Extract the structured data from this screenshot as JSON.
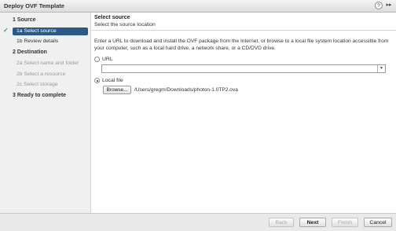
{
  "window": {
    "title": "Deploy OVF Template",
    "help_icon": "?",
    "expand_icon": "▸▸"
  },
  "sidebar": {
    "steps": [
      {
        "number": "1",
        "label": "Source"
      },
      {
        "number": "2",
        "label": "Destination"
      },
      {
        "number": "3",
        "label": "Ready to complete"
      }
    ],
    "substeps": [
      {
        "label": "1a  Select source",
        "state": "active",
        "completed": true
      },
      {
        "label": "1b  Review details",
        "state": "enabled"
      },
      {
        "label": "2a  Select name and folder",
        "state": "disabled"
      },
      {
        "label": "2b  Select a resource",
        "state": "disabled"
      },
      {
        "label": "2c  Select storage",
        "state": "disabled"
      }
    ],
    "step_titles": [
      "1  Source",
      "2  Destination",
      "3  Ready to complete"
    ]
  },
  "main": {
    "title": "Select source",
    "subtitle": "Select the source location",
    "description": "Enter a URL to download and install the OVF package from the Internet, or browse to a local file system location accessible from your computer, such as a local hard drive, a network share, or a CD/DVD drive.",
    "url_option": {
      "label": "URL",
      "selected": false,
      "value": ""
    },
    "local_option": {
      "label": "Local file",
      "selected": true
    },
    "browse_label": "Browse...",
    "file_path": "/Users/gregm/Downloads/photon-1.0TP2.ova"
  },
  "footer": {
    "back_label": "Back",
    "next_label": "Next",
    "finish_label": "Finish",
    "cancel_label": "Cancel"
  },
  "colors": {
    "active_item_bg": "#2b5a88",
    "check_green": "#3aa24a"
  }
}
